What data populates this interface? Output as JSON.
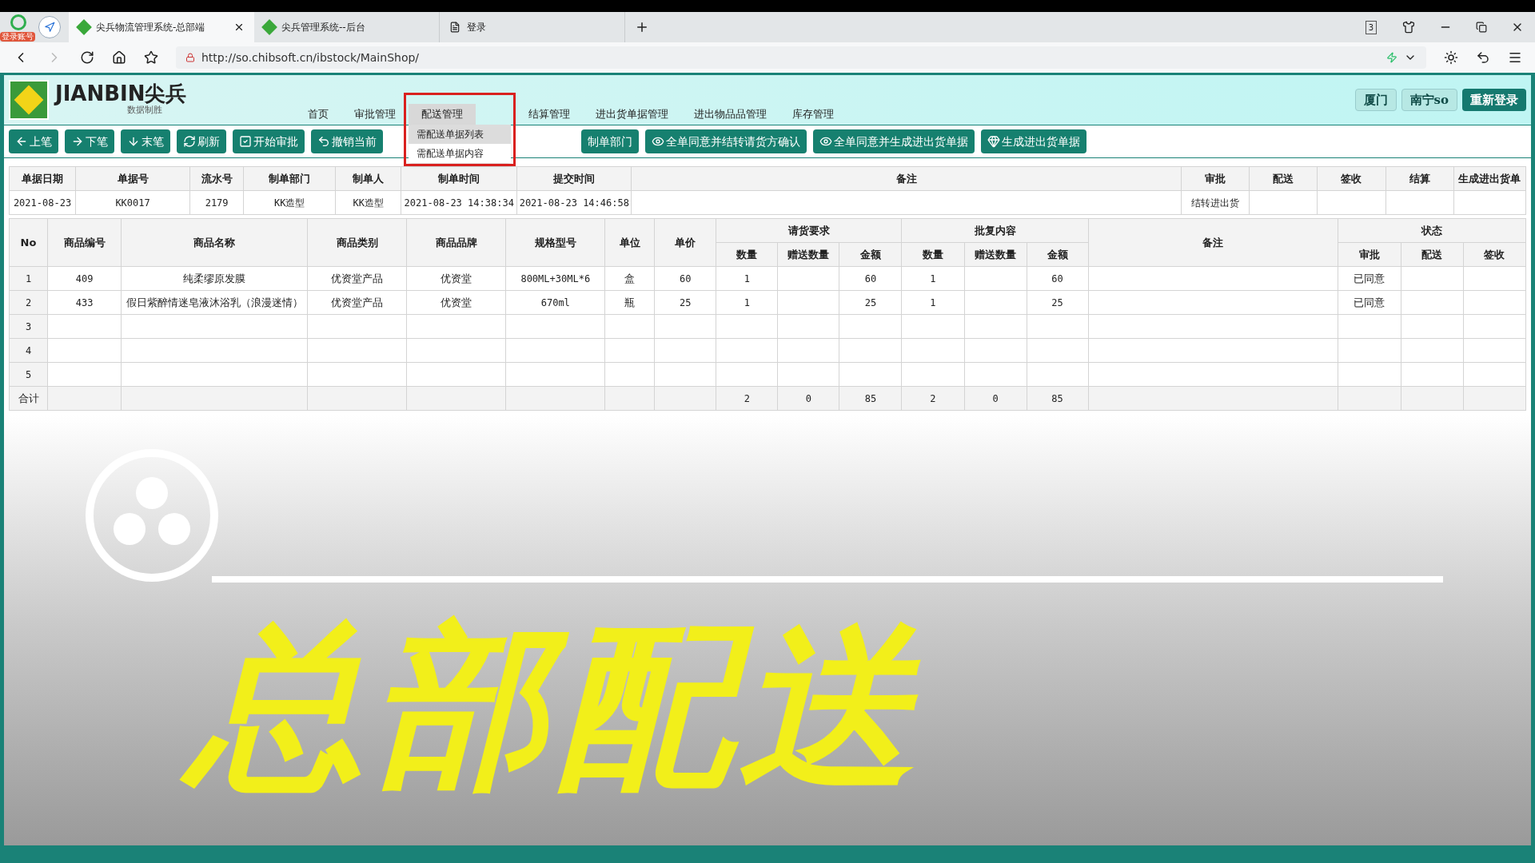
{
  "browser": {
    "badge": "登录账号",
    "tabs": [
      {
        "title": "尖兵物流管理系统-总部端",
        "selected": true,
        "kind": "site"
      },
      {
        "title": "尖兵管理系统--后台",
        "selected": false,
        "kind": "site"
      },
      {
        "title": "登录",
        "selected": false,
        "kind": "page"
      }
    ],
    "tab_count": "3",
    "url": "http://so.chibsoft.cn/ibstock/MainShop/"
  },
  "header": {
    "logo_text": "JIANBIN尖兵",
    "slogan": "数据制胜",
    "nav": [
      {
        "label": "首页",
        "selected": false
      },
      {
        "label": "审批管理",
        "selected": false
      },
      {
        "label": "配送管理",
        "selected": true
      },
      {
        "label": "结算管理",
        "selected": false
      },
      {
        "label": "进出货单据管理",
        "selected": false
      },
      {
        "label": "进出物品品管理",
        "selected": false
      },
      {
        "label": "库存管理",
        "selected": false
      }
    ],
    "dropdown": [
      {
        "label": "需配送单据列表",
        "selected": true
      },
      {
        "label": "需配送单据内容",
        "selected": false
      }
    ],
    "actions": [
      {
        "label": "厦门",
        "kind": "light"
      },
      {
        "label": "南宁so",
        "kind": "light"
      },
      {
        "label": "重新登录",
        "kind": "dark"
      }
    ]
  },
  "toolbar": [
    {
      "label": "上笔"
    },
    {
      "label": "下笔"
    },
    {
      "label": "末笔"
    },
    {
      "label": "刷新"
    },
    {
      "label": "开始审批"
    },
    {
      "label": "撤销当前"
    },
    {
      "label": "制单部门"
    },
    {
      "label": "全单同意并结转请货方确认"
    },
    {
      "label": "全单同意并生成进出货单据"
    },
    {
      "label": "生成进出货单据"
    }
  ],
  "info_table": {
    "columns": [
      "单据日期",
      "单据号",
      "流水号",
      "制单部门",
      "制单人",
      "制单时间",
      "提交时间",
      "备注",
      "审批",
      "配送",
      "签收",
      "结算",
      "生成进出货单"
    ],
    "values": {
      "date": "2021-08-23",
      "number": "KK0017",
      "serial": "2179",
      "department": "KK造型",
      "creator": "KK造型",
      "created_time": "2021-08-23 14:38:34",
      "submitted_time": "2021-08-23 14:46:58",
      "approval": "结转进出货"
    }
  },
  "items_table": {
    "group_headers": [
      "请货要求",
      "批复内容",
      "状态"
    ],
    "columns": [
      "No",
      "商品编号",
      "商品名称",
      "商品类别",
      "商品品牌",
      "规格型号",
      "单位",
      "单价",
      "数量",
      "赠送数量",
      "金额",
      "数量",
      "赠送数量",
      "金额",
      "备注",
      "审批",
      "配送",
      "签收"
    ],
    "rows": [
      {
        "no": "1",
        "code": "409",
        "name": "纯柔缪原发膜",
        "category": "优资堂产品",
        "brand": "优资堂",
        "spec": "800ML+30ML*6",
        "unit": "盒",
        "price": "60",
        "req_qty": "1",
        "req_amount": "60",
        "rep_qty": "1",
        "rep_amount": "60",
        "approval": "已同意"
      },
      {
        "no": "2",
        "code": "433",
        "name": "假日紫醉情迷皂液沐浴乳（浪漫迷情）",
        "category": "优资堂产品",
        "brand": "优资堂",
        "spec": "670ml",
        "unit": "瓶",
        "price": "25",
        "req_qty": "1",
        "req_amount": "25",
        "rep_qty": "1",
        "rep_amount": "25",
        "approval": "已同意"
      },
      {
        "no": "3"
      },
      {
        "no": "4"
      },
      {
        "no": "5"
      }
    ],
    "total": {
      "no": "合计",
      "req_qty": "2",
      "req_gift": "0",
      "req_amount": "85",
      "rep_qty": "2",
      "rep_gift": "0",
      "rep_amount": "85"
    }
  },
  "overlay_title": "总部配送"
}
